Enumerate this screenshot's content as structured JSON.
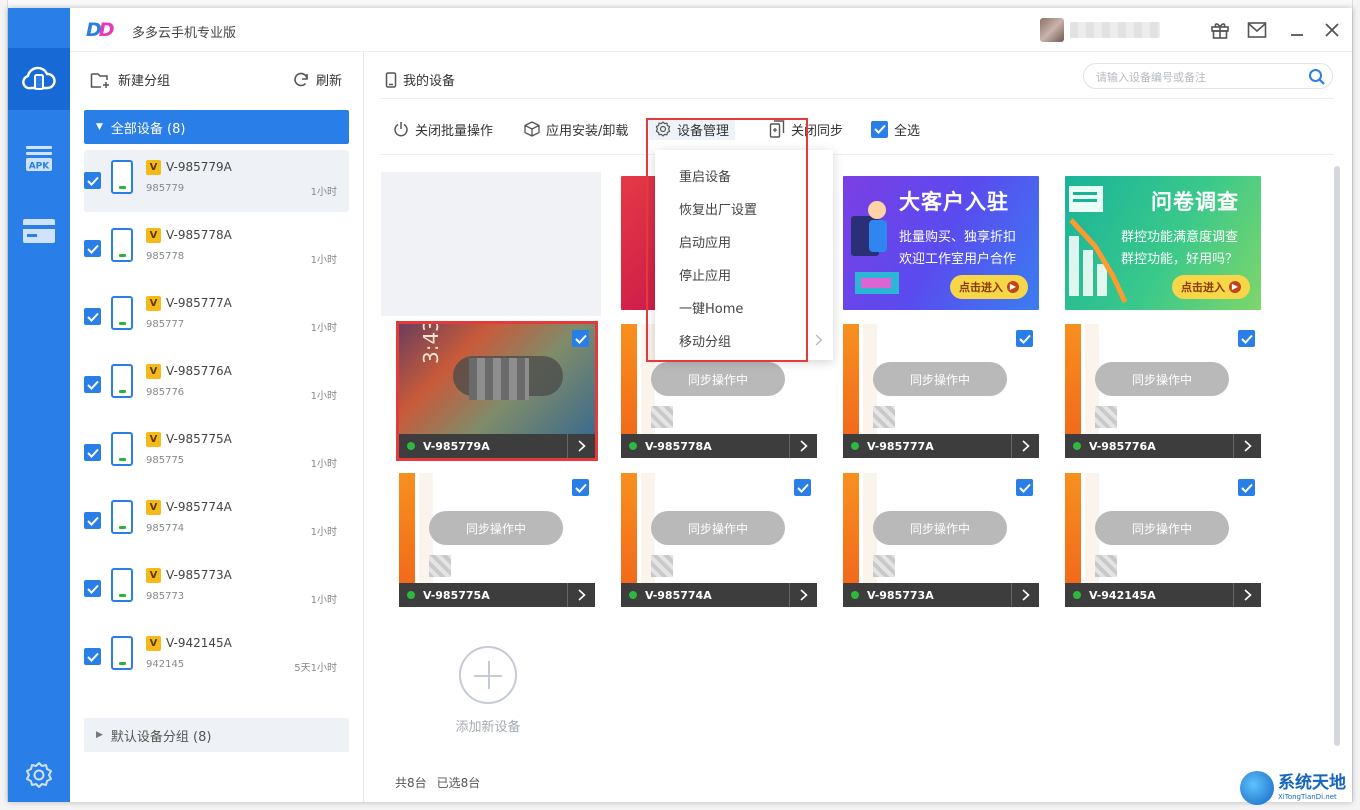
{
  "header": {
    "logo_left": "D",
    "logo_right": "D",
    "app_title": "多多云手机专业版"
  },
  "sidebar": {
    "new_group": "新建分组",
    "refresh": "刷新",
    "group_all": "全部设备 (8)",
    "group_default": "默认设备分组 (8)",
    "badge": "V",
    "devices": [
      {
        "name": "V-985779A",
        "id": "985779",
        "time": "1小时"
      },
      {
        "name": "V-985778A",
        "id": "985778",
        "time": "1小时"
      },
      {
        "name": "V-985777A",
        "id": "985777",
        "time": "1小时"
      },
      {
        "name": "V-985776A",
        "id": "985776",
        "time": "1小时"
      },
      {
        "name": "V-985775A",
        "id": "985775",
        "time": "1小时"
      },
      {
        "name": "V-985774A",
        "id": "985774",
        "time": "1小时"
      },
      {
        "name": "V-985773A",
        "id": "985773",
        "time": "1小时"
      },
      {
        "name": "V-942145A",
        "id": "942145",
        "time": "5天1小时"
      }
    ]
  },
  "main": {
    "crumb": "我的设备",
    "search_placeholder": "请输入设备编号或备注",
    "toolbar": {
      "close_batch": "关闭批量操作",
      "app_install": "应用安装/卸载",
      "device_manage": "设备管理",
      "close_sync": "关闭同步",
      "select_all": "全选"
    },
    "menu": [
      "重启设备",
      "恢复出厂设置",
      "启动应用",
      "停止应用",
      "一键Home",
      "移动分组"
    ],
    "sync_label": "同步操作中",
    "tiles": [
      "V-985779A",
      "V-985778A",
      "V-985777A",
      "V-985776A",
      "V-985775A",
      "V-985774A",
      "V-985773A",
      "V-942145A"
    ],
    "ads": [
      {
        "title": "大客户入驻",
        "line1": "批量购买、独享折扣",
        "line2": "欢迎工作室用户合作",
        "button": "点击进入"
      },
      {
        "title": "问卷调查",
        "line1": "群控功能满意度调查",
        "line2": "群控功能，好用吗？",
        "button": "点击进入"
      }
    ],
    "add_device": "添加新设备",
    "footer_total": "共8台",
    "footer_selected": "已选8台",
    "phone_time": "3:43"
  },
  "watermark": {
    "title": "系统天地",
    "url": "XiTongTianDi.net"
  },
  "colors": {
    "accent": "#2a7ee8",
    "highlight": "#e43a3a",
    "online": "#2fb83f",
    "badge": "#f5b919"
  },
  "icons": [
    "cloud-phone-icon",
    "apk-icon",
    "card-icon",
    "settings-icon",
    "gift-icon",
    "mail-icon",
    "minimize-icon",
    "close-icon",
    "new-group-icon",
    "refresh-icon",
    "search-icon",
    "power-icon",
    "cube-icon",
    "gear-icon",
    "sync-icon",
    "check-icon",
    "chevron-right-icon"
  ]
}
